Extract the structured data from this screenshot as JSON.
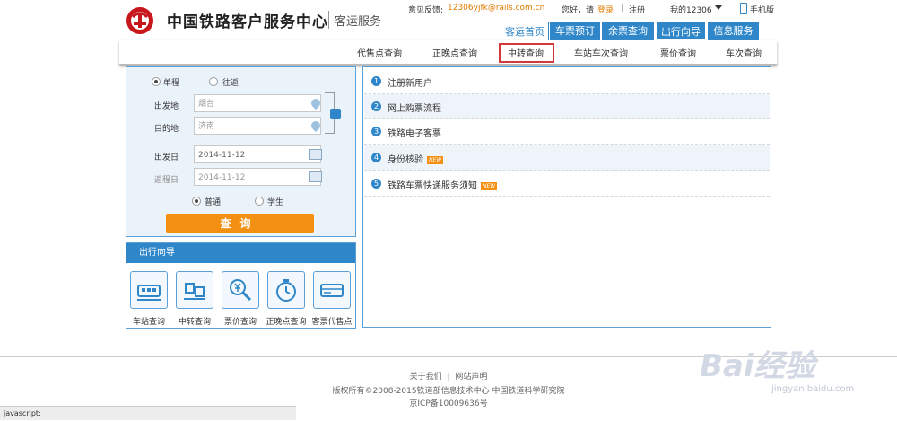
{
  "header": {
    "logo_text": "中国铁路客户服务中心",
    "logo_sub": "客运服务",
    "feedback_label": "意见反馈:",
    "feedback_email": "12306yjfk@rails.com.cn",
    "greeting": "您好，请",
    "login": "登录",
    "register": "注册",
    "my12306": "我的12306",
    "mobile": "手机版"
  },
  "main_nav": [
    {
      "label": "客运首页",
      "active": true
    },
    {
      "label": "车票预订"
    },
    {
      "label": "余票查询"
    },
    {
      "label": "出行向导"
    },
    {
      "label": "信息服务"
    }
  ],
  "sub_nav": [
    "代售点查询",
    "正晚点查询",
    "中转查询",
    "车站车次查询",
    "票价查询",
    "车次查询"
  ],
  "search": {
    "one_way": "单程",
    "round_trip": "往返",
    "from_label": "出发地",
    "from_value": "烟台",
    "to_label": "目的地",
    "to_value": "济南",
    "depart_label": "出发日",
    "depart_value": "2014-11-12",
    "return_label": "返程日",
    "return_value": "2014-11-12",
    "normal": "普通",
    "student": "学生",
    "query_button": "查询"
  },
  "guide": {
    "title": "出行向导",
    "items": [
      "车站查询",
      "中转查询",
      "票价查询",
      "正晚点查询",
      "客票代售点"
    ]
  },
  "notices": [
    {
      "num": "1",
      "text": "注册新用户",
      "new": false
    },
    {
      "num": "2",
      "text": "网上购票流程",
      "new": false
    },
    {
      "num": "3",
      "text": "铁路电子客票",
      "new": false
    },
    {
      "num": "4",
      "text": "身份核验",
      "new": true
    },
    {
      "num": "5",
      "text": "铁路车票快递服务须知",
      "new": true
    }
  ],
  "new_badge": "NEW",
  "footer": {
    "about": "关于我们",
    "statement": "网站声明",
    "copyright": "版权所有©2008-2015铁道部信息技术中心   中国铁道科学研究院",
    "icp": "京ICP备10009636号"
  },
  "status_bar": "javascript:",
  "watermark": {
    "brand": "Bai经验",
    "url": "jingyan.baidu.com"
  }
}
